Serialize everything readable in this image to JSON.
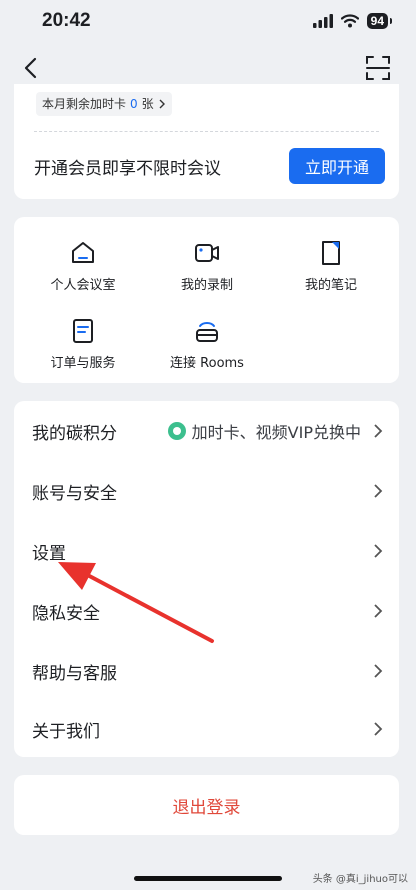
{
  "status_bar": {
    "time": "20:42",
    "battery": "94"
  },
  "member_card": {
    "extra_time_label": "本月剩余加时卡",
    "extra_time_count": "0",
    "extra_time_unit": "张",
    "promo_text": "开通会员即享不限时会议",
    "open_button": "立即开通"
  },
  "grid": [
    {
      "label": "个人会议室",
      "icon": "home-icon"
    },
    {
      "label": "我的录制",
      "icon": "video-icon"
    },
    {
      "label": "我的笔记",
      "icon": "note-icon"
    },
    {
      "label": "订单与服务",
      "icon": "order-icon"
    },
    {
      "label": "连接 Rooms",
      "icon": "rooms-icon"
    }
  ],
  "menu": [
    {
      "label": "我的碳积分",
      "sub": "加时卡、视频VIP兑换中"
    },
    {
      "label": "账号与安全"
    },
    {
      "label": "设置"
    },
    {
      "label": "隐私安全"
    },
    {
      "label": "帮助与客服"
    },
    {
      "label": "关于我们"
    }
  ],
  "logout": "退出登录",
  "watermark": "头条 @真i_jihuo可以",
  "colors": {
    "accent": "#1a6cf0",
    "danger": "#e0483a",
    "annotation_arrow": "#e8322d"
  }
}
